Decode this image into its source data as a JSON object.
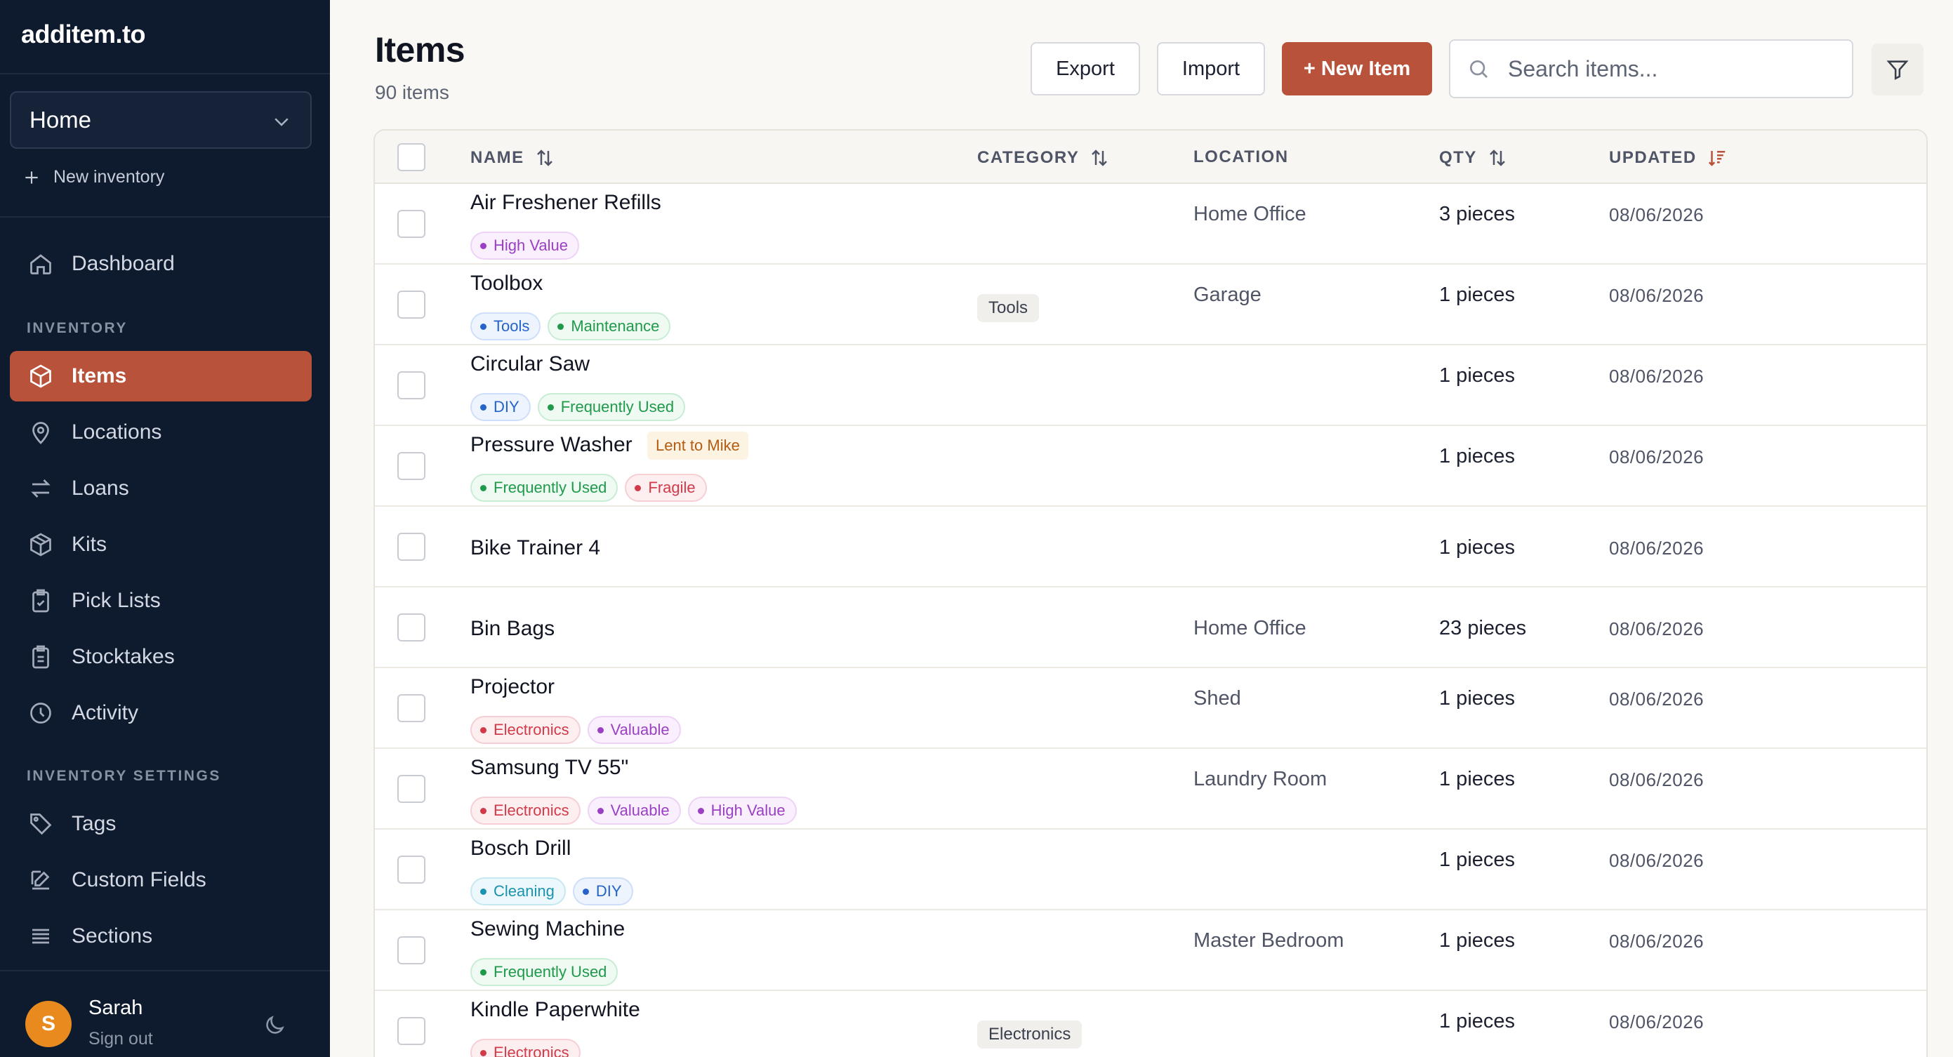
{
  "app": {
    "brand": "additem.to"
  },
  "sidebar": {
    "inventory_select": "Home",
    "new_inventory": "New inventory",
    "dashboard": "Dashboard",
    "section_inventory": "INVENTORY",
    "section_settings": "INVENTORY SETTINGS",
    "nav": [
      {
        "label": "Items",
        "icon": "box-icon",
        "active": true
      },
      {
        "label": "Locations",
        "icon": "map-pin-icon"
      },
      {
        "label": "Loans",
        "icon": "swap-arrows-icon"
      },
      {
        "label": "Kits",
        "icon": "package-icon"
      },
      {
        "label": "Pick Lists",
        "icon": "clipboard-check-icon"
      },
      {
        "label": "Stocktakes",
        "icon": "clipboard-icon"
      },
      {
        "label": "Activity",
        "icon": "clock-icon"
      }
    ],
    "settings_nav": [
      {
        "label": "Tags",
        "icon": "tag-icon"
      },
      {
        "label": "Custom Fields",
        "icon": "edit-icon"
      },
      {
        "label": "Sections",
        "icon": "list-icon"
      }
    ],
    "user": {
      "initial": "S",
      "name": "Sarah",
      "signout": "Sign out"
    }
  },
  "header": {
    "title": "Items",
    "count": "90 items",
    "export": "Export",
    "import": "Import",
    "new_item": "+ New Item",
    "search_placeholder": "Search items..."
  },
  "table": {
    "columns": {
      "name": "NAME",
      "category": "CATEGORY",
      "location": "LOCATION",
      "qty": "QTY",
      "updated": "UPDATED"
    },
    "sort": {
      "column": "UPDATED",
      "direction": "descending"
    },
    "rows": [
      {
        "name": "Air Freshener Refills",
        "tags": [
          {
            "label": "High Value",
            "color": "purple"
          }
        ],
        "category": "",
        "location": "Home Office",
        "qty": "3 pieces",
        "updated": "08/06/2026"
      },
      {
        "name": "Toolbox",
        "tags": [
          {
            "label": "Tools",
            "color": "blue"
          },
          {
            "label": "Maintenance",
            "color": "green"
          }
        ],
        "category": "Tools",
        "location": "Garage",
        "qty": "1 pieces",
        "updated": "08/06/2026"
      },
      {
        "name": "Circular Saw",
        "tags": [
          {
            "label": "DIY",
            "color": "blue"
          },
          {
            "label": "Frequently Used",
            "color": "green"
          }
        ],
        "category": "",
        "location": "",
        "qty": "1 pieces",
        "updated": "08/06/2026"
      },
      {
        "name": "Pressure Washer",
        "loan": "Lent to Mike",
        "tags": [
          {
            "label": "Frequently Used",
            "color": "green"
          },
          {
            "label": "Fragile",
            "color": "red"
          }
        ],
        "category": "",
        "location": "",
        "qty": "1 pieces",
        "updated": "08/06/2026"
      },
      {
        "name": "Bike Trainer 4",
        "tags": [],
        "category": "",
        "location": "",
        "qty": "1 pieces",
        "updated": "08/06/2026"
      },
      {
        "name": "Bin Bags",
        "tags": [],
        "category": "",
        "location": "Home Office",
        "qty": "23 pieces",
        "updated": "08/06/2026"
      },
      {
        "name": "Projector",
        "tags": [
          {
            "label": "Electronics",
            "color": "red"
          },
          {
            "label": "Valuable",
            "color": "purple"
          }
        ],
        "category": "",
        "location": "Shed",
        "qty": "1 pieces",
        "updated": "08/06/2026"
      },
      {
        "name": "Samsung TV 55\"",
        "tags": [
          {
            "label": "Electronics",
            "color": "red"
          },
          {
            "label": "Valuable",
            "color": "purple"
          },
          {
            "label": "High Value",
            "color": "purple"
          }
        ],
        "category": "",
        "location": "Laundry Room",
        "qty": "1 pieces",
        "updated": "08/06/2026"
      },
      {
        "name": "Bosch Drill",
        "tags": [
          {
            "label": "Cleaning",
            "color": "cyan"
          },
          {
            "label": "DIY",
            "color": "blue"
          }
        ],
        "category": "",
        "location": "",
        "qty": "1 pieces",
        "updated": "08/06/2026"
      },
      {
        "name": "Sewing Machine",
        "tags": [
          {
            "label": "Frequently Used",
            "color": "green"
          }
        ],
        "category": "",
        "location": "Master Bedroom",
        "qty": "1 pieces",
        "updated": "08/06/2026"
      },
      {
        "name": "Kindle Paperwhite",
        "tags": [
          {
            "label": "Electronics",
            "color": "red"
          }
        ],
        "category": "Electronics",
        "location": "",
        "qty": "1 pieces",
        "updated": "08/06/2026"
      }
    ]
  },
  "colors": {
    "accent": "#b8523a",
    "sidebar_bg": "#0e1a2e",
    "tag_purple": "#9b3fc4",
    "tag_blue": "#2563c9",
    "tag_green": "#1f9a4a",
    "tag_red": "#d23a4a",
    "tag_cyan": "#1a93b0"
  }
}
